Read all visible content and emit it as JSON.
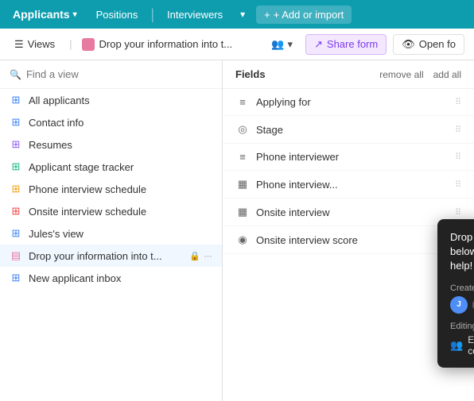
{
  "nav": {
    "brand": "Applicants",
    "tabs": [
      "Positions",
      "Interviewers"
    ],
    "dropdown_label": "▾",
    "add_label": "+ Add or import"
  },
  "toolbar": {
    "views_label": "Views",
    "view_name": "Drop your information into t...",
    "share_label": "Share form",
    "open_label": "Open fo"
  },
  "sidebar": {
    "search_placeholder": "Find a view",
    "items": [
      {
        "id": "all-applicants",
        "label": "All applicants",
        "color": "blue",
        "icon": "grid"
      },
      {
        "id": "contact-info",
        "label": "Contact info",
        "color": "blue",
        "icon": "grid"
      },
      {
        "id": "resumes",
        "label": "Resumes",
        "color": "purple",
        "icon": "grid4"
      },
      {
        "id": "applicant-stage-tracker",
        "label": "Applicant stage tracker",
        "color": "green",
        "icon": "grid-alt"
      },
      {
        "id": "phone-interview-schedule",
        "label": "Phone interview schedule",
        "color": "orange",
        "icon": "grid-orange"
      },
      {
        "id": "onsite-interview-schedule",
        "label": "Onsite interview schedule",
        "color": "red",
        "icon": "grid-red"
      },
      {
        "id": "jules-view",
        "label": "Jules's view",
        "color": "blue",
        "icon": "grid"
      },
      {
        "id": "drop-info",
        "label": "Drop your information into t...",
        "color": "pink",
        "icon": "form",
        "active": true
      },
      {
        "id": "new-applicant-inbox",
        "label": "New applicant inbox",
        "color": "blue",
        "icon": "grid"
      }
    ]
  },
  "fields": {
    "title": "Fields",
    "remove_all": "remove all",
    "add_all": "add all",
    "items": [
      {
        "id": "applying-for",
        "label": "Applying for",
        "icon": "≡"
      },
      {
        "id": "stage",
        "label": "Stage",
        "icon": "◎"
      },
      {
        "id": "phone-interviewer",
        "label": "Phone interviewer",
        "icon": "≡"
      },
      {
        "id": "phone-interview",
        "label": "Phone interview...",
        "icon": "▦"
      },
      {
        "id": "onsite-interview",
        "label": "Onsite interview",
        "icon": "▦"
      },
      {
        "id": "onsite-interview-score",
        "label": "Onsite interview score",
        "icon": "◉"
      }
    ]
  },
  "tooltip": {
    "title": "Drop your information into the form below and let us know how you want to help!",
    "created_by_label": "Created by",
    "user_name": "Jenn",
    "editing_label": "Editing",
    "editing_text": "Everyone can edit the view configuration."
  }
}
